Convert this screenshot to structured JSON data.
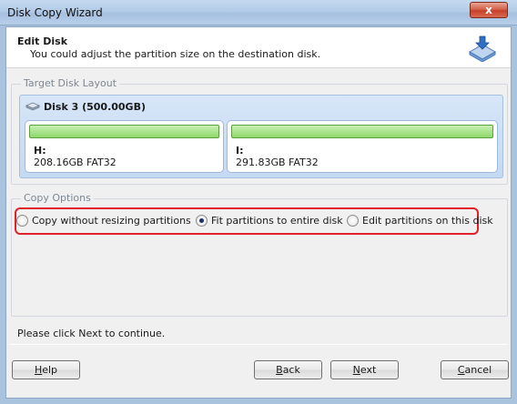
{
  "window": {
    "title": "Disk Copy Wizard",
    "close_glyph": "x"
  },
  "header": {
    "title": "Edit Disk",
    "subtitle": "You could adjust the partition size on the destination disk.",
    "icon": "disk-copy-icon"
  },
  "target_layout": {
    "legend": "Target Disk Layout",
    "disk_label": "Disk 3 (500.00GB)",
    "partitions": [
      {
        "letter": "H:",
        "info": "208.16GB FAT32",
        "used_fraction": 1.0
      },
      {
        "letter": "I:",
        "info": "291.83GB FAT32",
        "used_fraction": 1.0
      }
    ]
  },
  "copy_options": {
    "legend": "Copy Options",
    "highlight_color": "#e0202a",
    "options": [
      {
        "label": "Copy without resizing partitions",
        "checked": false
      },
      {
        "label": "Fit partitions to entire disk",
        "checked": true
      },
      {
        "label": "Edit partitions on this disk",
        "checked": false
      }
    ]
  },
  "hint": "Please click Next to continue.",
  "buttons": {
    "help": {
      "mnemonic": "H",
      "rest": "elp"
    },
    "back": {
      "mnemonic": "B",
      "rest": "ack"
    },
    "next": {
      "mnemonic": "N",
      "rest": "ext"
    },
    "cancel": {
      "mnemonic": "C",
      "rest": "ancel"
    }
  }
}
